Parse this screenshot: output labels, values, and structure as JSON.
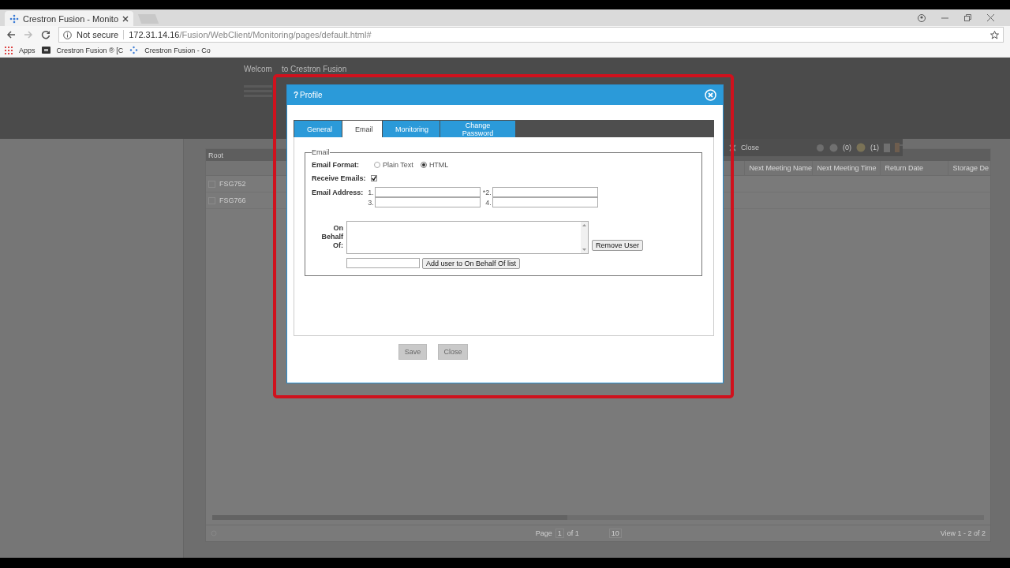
{
  "browser": {
    "tab_title": "Crestron Fusion - Monito",
    "security": "Not secure",
    "url_host": "172.31.14.16",
    "url_path": "/Fusion/WebClient/Monitoring/pages/default.html#",
    "bookmarks": [
      "Apps",
      "Crestron Fusion ® [C",
      "Crestron Fusion - Co"
    ]
  },
  "background": {
    "welcome": [
      "Welcom",
      "to Crestron Fusion"
    ],
    "grid_title": "Root",
    "columns": [
      "Next Meeting Name",
      "Next Meeting Time",
      "Return Date",
      "Storage De"
    ],
    "rows": [
      {
        "name": "FSG752",
        "checked": false
      },
      {
        "name": "FSG766",
        "checked": false
      }
    ],
    "toolbar": {
      "close": "Close",
      "count_1": "(0)",
      "count_2": "(1)"
    },
    "pager": {
      "page_label": "Page",
      "page": "1",
      "of": "of 1",
      "page_size": "10",
      "view": "View 1 - 2 of 2"
    }
  },
  "dialog": {
    "title": "Profile",
    "help": "?",
    "tabs": [
      {
        "label": "General",
        "selected": false
      },
      {
        "label": "Email",
        "selected": true
      },
      {
        "label": "Monitoring",
        "selected": false
      },
      {
        "label": "Change Password",
        "selected": false
      }
    ],
    "legend": "Email",
    "format_label": "Email Format:",
    "formats": [
      {
        "label": "Plain Text",
        "selected": false
      },
      {
        "label": "HTML",
        "selected": true
      }
    ],
    "receive_label": "Receive Emails:",
    "receive_checked": true,
    "address_label": "Email Address:",
    "address_numbers": [
      "1.",
      "*2.",
      "3.",
      "4."
    ],
    "behalf_label": "On Behalf Of:",
    "remove_button": "Remove User",
    "add_button": "Add user to On Behalf Of list",
    "footer_buttons": [
      "Save",
      "Close"
    ]
  }
}
